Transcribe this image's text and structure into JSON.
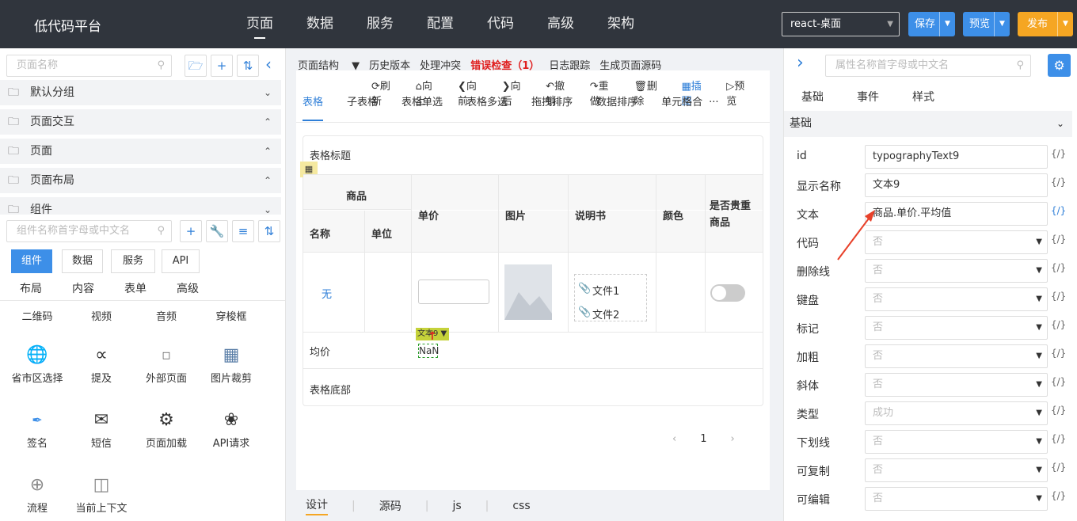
{
  "header": {
    "logo": "低代码平台",
    "nav": [
      "页面",
      "数据",
      "服务",
      "配置",
      "代码",
      "高级",
      "架构"
    ],
    "env_select": "react-桌面",
    "save": "保存",
    "preview": "预览",
    "publish": "发布"
  },
  "left": {
    "page_search_placeholder": "页面名称",
    "groups": [
      "默认分组",
      "页面交互",
      "页面",
      "页面布局",
      "组件"
    ],
    "comp_search_placeholder": "组件名称首字母或中文名",
    "tabs": [
      "组件",
      "数据",
      "服务",
      "API"
    ],
    "subtabs": [
      "布局",
      "内容",
      "表单",
      "高级"
    ],
    "items": [
      {
        "label": "二维码",
        "icon": "qrcode-icon"
      },
      {
        "label": "视频",
        "icon": "video-icon"
      },
      {
        "label": "音频",
        "icon": "audio-icon"
      },
      {
        "label": "穿梭框",
        "icon": "transfer-icon"
      },
      {
        "label": "省市区选择",
        "icon": "globe-icon"
      },
      {
        "label": "提及",
        "icon": "share-icon"
      },
      {
        "label": "外部页面",
        "icon": "html-icon"
      },
      {
        "label": "图片裁剪",
        "icon": "image-icon"
      },
      {
        "label": "签名",
        "icon": "signature-icon"
      },
      {
        "label": "短信",
        "icon": "mail-icon"
      },
      {
        "label": "页面加载",
        "icon": "gear-icon"
      },
      {
        "label": "API请求",
        "icon": "api-icon"
      },
      {
        "label": "流程",
        "icon": "flow-icon"
      },
      {
        "label": "当前上下文",
        "icon": "context-icon"
      }
    ]
  },
  "center": {
    "toolbar": [
      "页面结构",
      "历史版本",
      "处理冲突",
      "错误检查（1）",
      "日志跟踪",
      "生成页面源码"
    ],
    "actions": [
      "刷新",
      "向上",
      "向前",
      "向后",
      "撤销",
      "重做",
      "删除",
      "插图",
      "预览"
    ],
    "tabs": [
      "表格",
      "子表格",
      "表格单选",
      "表格多选",
      "拖拽排序",
      "数据排序",
      "单元格合"
    ],
    "more": "···",
    "table": {
      "title": "表格标题",
      "group_header": "商品",
      "headers": [
        "名称",
        "单位",
        "单价",
        "图片",
        "说明书",
        "颜色",
        "是否贵重商品"
      ],
      "row_name": "无",
      "files": [
        "文件1",
        "文件2"
      ],
      "avg_label": "均价",
      "avg_value": "NaN",
      "sel_label": "文本9",
      "footer": "表格底部"
    },
    "page_number": "1",
    "bottom_tabs": [
      "设计",
      "源码",
      "js",
      "css"
    ]
  },
  "right": {
    "search_placeholder": "属性名称首字母或中文名",
    "tabs": [
      "基础",
      "事件",
      "样式"
    ],
    "section": "基础",
    "props": [
      {
        "label": "id",
        "value": "typographyText9",
        "kind": "input"
      },
      {
        "label": "显示名称",
        "value": "文本9",
        "kind": "input"
      },
      {
        "label": "文本",
        "value": "商品.单价.平均值",
        "kind": "input"
      },
      {
        "label": "代码",
        "value": "否",
        "kind": "select"
      },
      {
        "label": "删除线",
        "value": "否",
        "kind": "select"
      },
      {
        "label": "键盘",
        "value": "否",
        "kind": "select"
      },
      {
        "label": "标记",
        "value": "否",
        "kind": "select"
      },
      {
        "label": "加粗",
        "value": "否",
        "kind": "select"
      },
      {
        "label": "斜体",
        "value": "否",
        "kind": "select"
      },
      {
        "label": "类型",
        "value": "成功",
        "kind": "select"
      },
      {
        "label": "下划线",
        "value": "否",
        "kind": "select"
      },
      {
        "label": "可复制",
        "value": "否",
        "kind": "select"
      },
      {
        "label": "可编辑",
        "value": "否",
        "kind": "select"
      }
    ],
    "code_glyph": "{/}"
  },
  "colors": {
    "accent": "#2f7fd8",
    "topbar": "#30353d",
    "publish": "#f5a623",
    "error": "#e02020",
    "arrow": "#e8412a"
  }
}
